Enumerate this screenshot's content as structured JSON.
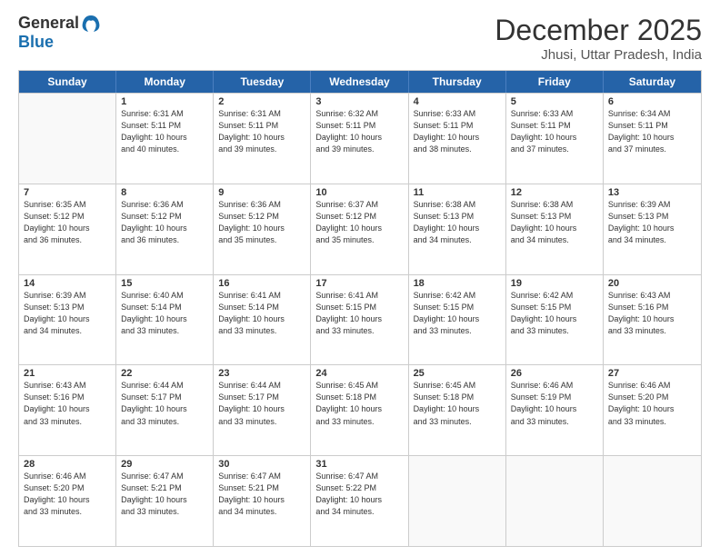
{
  "header": {
    "logo_general": "General",
    "logo_blue": "Blue",
    "month_title": "December 2025",
    "location": "Jhusi, Uttar Pradesh, India"
  },
  "days_of_week": [
    "Sunday",
    "Monday",
    "Tuesday",
    "Wednesday",
    "Thursday",
    "Friday",
    "Saturday"
  ],
  "weeks": [
    [
      {
        "day": "",
        "empty": true
      },
      {
        "day": "1",
        "sunrise": "6:31 AM",
        "sunset": "5:11 PM",
        "daylight": "10 hours and 40 minutes."
      },
      {
        "day": "2",
        "sunrise": "6:31 AM",
        "sunset": "5:11 PM",
        "daylight": "10 hours and 39 minutes."
      },
      {
        "day": "3",
        "sunrise": "6:32 AM",
        "sunset": "5:11 PM",
        "daylight": "10 hours and 39 minutes."
      },
      {
        "day": "4",
        "sunrise": "6:33 AM",
        "sunset": "5:11 PM",
        "daylight": "10 hours and 38 minutes."
      },
      {
        "day": "5",
        "sunrise": "6:33 AM",
        "sunset": "5:11 PM",
        "daylight": "10 hours and 37 minutes."
      },
      {
        "day": "6",
        "sunrise": "6:34 AM",
        "sunset": "5:11 PM",
        "daylight": "10 hours and 37 minutes."
      }
    ],
    [
      {
        "day": "7",
        "sunrise": "6:35 AM",
        "sunset": "5:12 PM",
        "daylight": "10 hours and 36 minutes."
      },
      {
        "day": "8",
        "sunrise": "6:36 AM",
        "sunset": "5:12 PM",
        "daylight": "10 hours and 36 minutes."
      },
      {
        "day": "9",
        "sunrise": "6:36 AM",
        "sunset": "5:12 PM",
        "daylight": "10 hours and 35 minutes."
      },
      {
        "day": "10",
        "sunrise": "6:37 AM",
        "sunset": "5:12 PM",
        "daylight": "10 hours and 35 minutes."
      },
      {
        "day": "11",
        "sunrise": "6:38 AM",
        "sunset": "5:13 PM",
        "daylight": "10 hours and 34 minutes."
      },
      {
        "day": "12",
        "sunrise": "6:38 AM",
        "sunset": "5:13 PM",
        "daylight": "10 hours and 34 minutes."
      },
      {
        "day": "13",
        "sunrise": "6:39 AM",
        "sunset": "5:13 PM",
        "daylight": "10 hours and 34 minutes."
      }
    ],
    [
      {
        "day": "14",
        "sunrise": "6:39 AM",
        "sunset": "5:13 PM",
        "daylight": "10 hours and 34 minutes."
      },
      {
        "day": "15",
        "sunrise": "6:40 AM",
        "sunset": "5:14 PM",
        "daylight": "10 hours and 33 minutes."
      },
      {
        "day": "16",
        "sunrise": "6:41 AM",
        "sunset": "5:14 PM",
        "daylight": "10 hours and 33 minutes."
      },
      {
        "day": "17",
        "sunrise": "6:41 AM",
        "sunset": "5:15 PM",
        "daylight": "10 hours and 33 minutes."
      },
      {
        "day": "18",
        "sunrise": "6:42 AM",
        "sunset": "5:15 PM",
        "daylight": "10 hours and 33 minutes."
      },
      {
        "day": "19",
        "sunrise": "6:42 AM",
        "sunset": "5:15 PM",
        "daylight": "10 hours and 33 minutes."
      },
      {
        "day": "20",
        "sunrise": "6:43 AM",
        "sunset": "5:16 PM",
        "daylight": "10 hours and 33 minutes."
      }
    ],
    [
      {
        "day": "21",
        "sunrise": "6:43 AM",
        "sunset": "5:16 PM",
        "daylight": "10 hours and 33 minutes."
      },
      {
        "day": "22",
        "sunrise": "6:44 AM",
        "sunset": "5:17 PM",
        "daylight": "10 hours and 33 minutes."
      },
      {
        "day": "23",
        "sunrise": "6:44 AM",
        "sunset": "5:17 PM",
        "daylight": "10 hours and 33 minutes."
      },
      {
        "day": "24",
        "sunrise": "6:45 AM",
        "sunset": "5:18 PM",
        "daylight": "10 hours and 33 minutes."
      },
      {
        "day": "25",
        "sunrise": "6:45 AM",
        "sunset": "5:18 PM",
        "daylight": "10 hours and 33 minutes."
      },
      {
        "day": "26",
        "sunrise": "6:46 AM",
        "sunset": "5:19 PM",
        "daylight": "10 hours and 33 minutes."
      },
      {
        "day": "27",
        "sunrise": "6:46 AM",
        "sunset": "5:20 PM",
        "daylight": "10 hours and 33 minutes."
      }
    ],
    [
      {
        "day": "28",
        "sunrise": "6:46 AM",
        "sunset": "5:20 PM",
        "daylight": "10 hours and 33 minutes."
      },
      {
        "day": "29",
        "sunrise": "6:47 AM",
        "sunset": "5:21 PM",
        "daylight": "10 hours and 33 minutes."
      },
      {
        "day": "30",
        "sunrise": "6:47 AM",
        "sunset": "5:21 PM",
        "daylight": "10 hours and 34 minutes."
      },
      {
        "day": "31",
        "sunrise": "6:47 AM",
        "sunset": "5:22 PM",
        "daylight": "10 hours and 34 minutes."
      },
      {
        "day": "",
        "empty": true
      },
      {
        "day": "",
        "empty": true
      },
      {
        "day": "",
        "empty": true
      }
    ]
  ],
  "labels": {
    "sunrise": "Sunrise:",
    "sunset": "Sunset:",
    "daylight": "Daylight:"
  }
}
